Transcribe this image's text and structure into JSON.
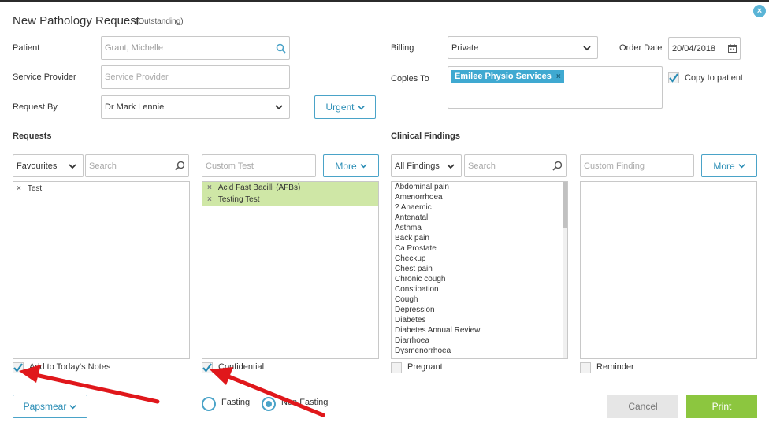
{
  "dialog": {
    "title": "New Pathology Request",
    "subtitle": "(Outstanding)",
    "close_label": "×"
  },
  "patient": {
    "label": "Patient",
    "value": "Grant, Michelle"
  },
  "service_provider": {
    "label": "Service Provider",
    "placeholder": "Service Provider"
  },
  "request_by": {
    "label": "Request By",
    "value": "Dr Mark Lennie"
  },
  "urgent_button": "Urgent",
  "billing": {
    "label": "Billing",
    "value": "Private"
  },
  "order_date": {
    "label": "Order Date",
    "value": "20/04/2018"
  },
  "copies_to": {
    "label": "Copies To",
    "tag": "Emilee Physio Services",
    "tag_remove": "×"
  },
  "copy_to_patient": {
    "label": "Copy to patient",
    "checked": true
  },
  "requests": {
    "title": "Requests",
    "filter": "Favourites",
    "search_placeholder": "Search",
    "favourites": [
      {
        "remove": "×",
        "label": "Test"
      }
    ],
    "custom_placeholder": "Custom Test",
    "more_label": "More",
    "selected": [
      {
        "remove": "×",
        "label": "Acid Fast Bacilli (AFBs)"
      },
      {
        "remove": "×",
        "label": "Testing Test"
      }
    ],
    "add_to_notes": {
      "label": "Add to Today's Notes",
      "checked": true
    },
    "confidential": {
      "label": "Confidential",
      "checked": true
    }
  },
  "clinical": {
    "title": "Clinical Findings",
    "filter": "All Findings",
    "search_placeholder": "Search",
    "findings": [
      "Abdominal pain",
      "Amenorrhoea",
      "? Anaemic",
      "Antenatal",
      "Asthma",
      "Back pain",
      "Ca Prostate",
      "Checkup",
      "Chest pain",
      "Chronic cough",
      "Constipation",
      "Cough",
      "Depression",
      "Diabetes",
      "Diabetes Annual Review",
      "Diarrhoea",
      "Dysmenorrhoea"
    ],
    "custom_placeholder": "Custom Finding",
    "more_label": "More",
    "pregnant": {
      "label": "Pregnant",
      "checked": false
    },
    "reminder": {
      "label": "Reminder",
      "checked": false
    }
  },
  "papsmear_button": "Papsmear",
  "fasting": {
    "option_fasting": "Fasting",
    "option_non_fasting": "Non Fasting",
    "selected": "Non Fasting"
  },
  "actions": {
    "cancel": "Cancel",
    "print": "Print"
  },
  "annotation": {
    "arrow_color": "#e0171b"
  },
  "colors": {
    "accent": "#4aa3c8",
    "print_green": "#8cc63f",
    "selected_row": "#cfe7a6"
  }
}
